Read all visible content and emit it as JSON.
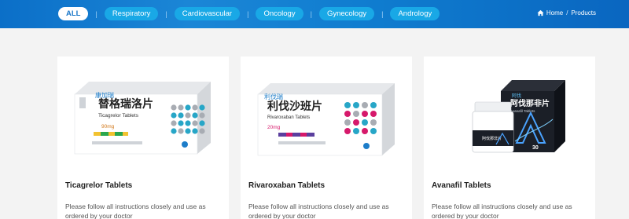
{
  "nav": {
    "categories": [
      {
        "label": "ALL",
        "active": true
      },
      {
        "label": "Respiratory"
      },
      {
        "label": "Cardiovascular"
      },
      {
        "label": "Oncology"
      },
      {
        "label": "Gynecology"
      },
      {
        "label": "Andrology"
      }
    ],
    "separator": "|"
  },
  "breadcrumb": {
    "home": "Home",
    "separator": "/",
    "current": "Products"
  },
  "products": [
    {
      "title": "Ticagrelor Tablets",
      "description": "Please follow all instructions closely and use as ordered by your doctor",
      "box": {
        "brand": "康加瑞",
        "cn_name": "替格瑞洛片",
        "en_name": "Ticagrelor Tablets",
        "dose": "90mg"
      }
    },
    {
      "title": "Rivaroxaban Tablets",
      "description": "Please follow all instructions closely and use as ordered by your doctor",
      "box": {
        "brand": "利伐瑞",
        "cn_name": "利伐沙班片",
        "en_name": "Rivaroxaban Tablets",
        "dose": "20mg"
      }
    },
    {
      "title": "Avanafil Tablets",
      "description": "Please follow all instructions closely and use as ordered by your doctor",
      "box": {
        "brand": "阿伐",
        "cn_name": "阿伐那非片",
        "en_name": "Avanafil Tablets",
        "dose": "30",
        "bottle_label": "阿伐那非片"
      }
    }
  ],
  "colors": {
    "nav_bg": "#0b6fc8",
    "pill": "#19a8e6",
    "teal": "#27a6c7",
    "magenta": "#d6196b",
    "gray": "#a8acb3"
  }
}
